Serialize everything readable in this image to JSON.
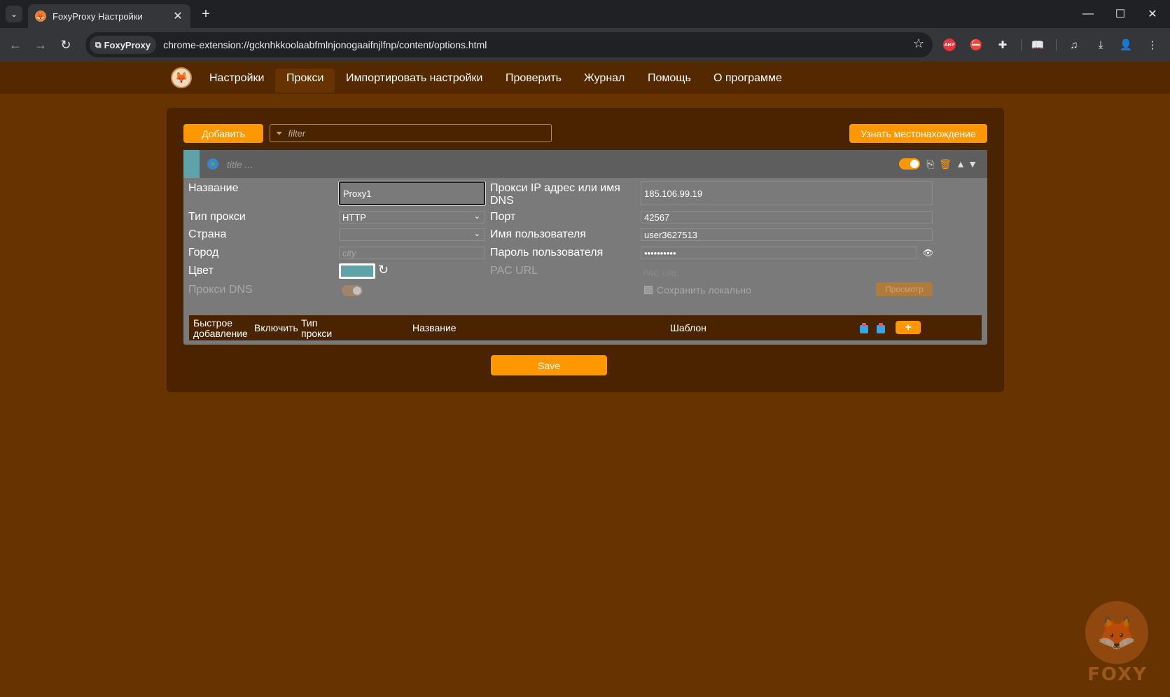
{
  "browser": {
    "tab_title": "FoxyProxy Настройки",
    "site_chip": "FoxyProxy",
    "url": "chrome-extension://gcknhkkoolaabfmlnjonogaaifnjlfnp/content/options.html",
    "abp_label": "ABP"
  },
  "nav": {
    "items": [
      {
        "label": "Настройки"
      },
      {
        "label": "Прокси"
      },
      {
        "label": "Импортировать настройки"
      },
      {
        "label": "Проверить"
      },
      {
        "label": "Журнал"
      },
      {
        "label": "Помощь"
      },
      {
        "label": "О программе"
      }
    ],
    "active": "Прокси"
  },
  "toolbar": {
    "add_label": "Добавить",
    "filter_placeholder": "filter",
    "location_label": "Узнать местонахождение"
  },
  "proxy": {
    "title_placeholder": "title ...",
    "enabled": true,
    "color": "#5fa3a8",
    "name_label": "Название",
    "name_value": "Proxy1",
    "type_label": "Тип прокси",
    "type_value": "HTTP",
    "country_label": "Страна",
    "country_value": "",
    "city_label": "Город",
    "city_placeholder": "city",
    "color_label": "Цвет",
    "dns_label": "Прокси DNS",
    "host_label": "Прокси IP адрес или имя DNS",
    "host_value": "185.106.99.19",
    "port_label": "Порт",
    "port_value": "42567",
    "user_label": "Имя пользователя",
    "user_value": "user3627513",
    "pass_label": "Пароль пользователя",
    "pass_value": "••••••••••",
    "pac_label": "PAC URL",
    "pac_placeholder": "PAC URL",
    "save_local_label": "Сохранить локально",
    "view_label": "Просмотр"
  },
  "patterns": {
    "quick_add": "Быстрое добавление",
    "enable": "Включить",
    "type": "Тип прокси",
    "name": "Название",
    "pattern": "Шаблон",
    "add_symbol": "+"
  },
  "save_label": "Save",
  "watermark_text": "FOXY",
  "colors": {
    "accent": "#ff9800",
    "page_bg": "#673300",
    "nav_bg": "#542900",
    "panel_bg": "#4a2400",
    "card_bg": "#7a7a7a"
  }
}
